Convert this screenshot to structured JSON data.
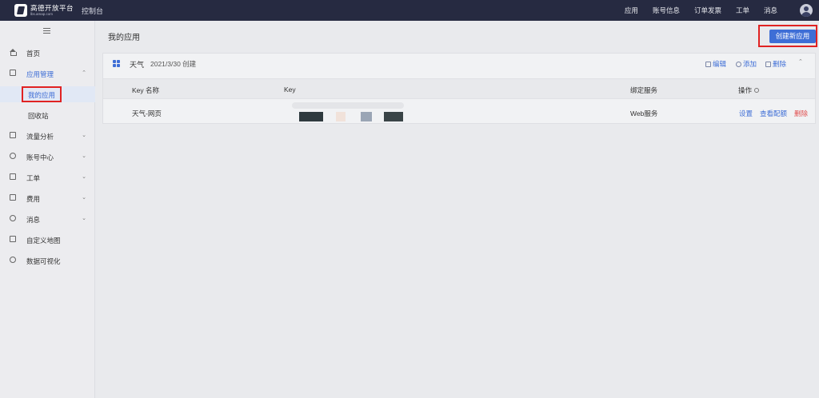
{
  "topbar": {
    "logo_cn": "高德开放平台",
    "logo_en": "lbs.amap.com",
    "console": "控制台",
    "nav": [
      "应用",
      "账号信息",
      "订单发票",
      "工单",
      "消息"
    ]
  },
  "sidebar": {
    "items": [
      {
        "label": "首页"
      },
      {
        "label": "应用管理"
      },
      {
        "label": "流量分析"
      },
      {
        "label": "账号中心"
      },
      {
        "label": "工单"
      },
      {
        "label": "费用"
      },
      {
        "label": "消息"
      },
      {
        "label": "自定义地图"
      },
      {
        "label": "数据可视化"
      }
    ],
    "sub_items": [
      {
        "label": "我的应用"
      },
      {
        "label": "回收站"
      }
    ]
  },
  "main": {
    "page_title": "我的应用",
    "create_button": "创建新应用",
    "app": {
      "name": "天气",
      "created": "2021/3/30 创建",
      "actions": {
        "edit": "编辑",
        "add": "添加",
        "delete": "删除"
      }
    },
    "table": {
      "headers": {
        "key_name": "Key 名称",
        "key": "Key",
        "service": "绑定服务",
        "ops": "操作"
      },
      "rows": [
        {
          "key_name": "天气-网页",
          "service": "Web服务",
          "settings": "设置",
          "quota": "查看配额",
          "delete": "删除"
        }
      ]
    }
  },
  "colors": {
    "accent": "#3e6ed6",
    "topbar": "#262a41",
    "danger": "#e04b4b",
    "highlight": "#e02222"
  }
}
